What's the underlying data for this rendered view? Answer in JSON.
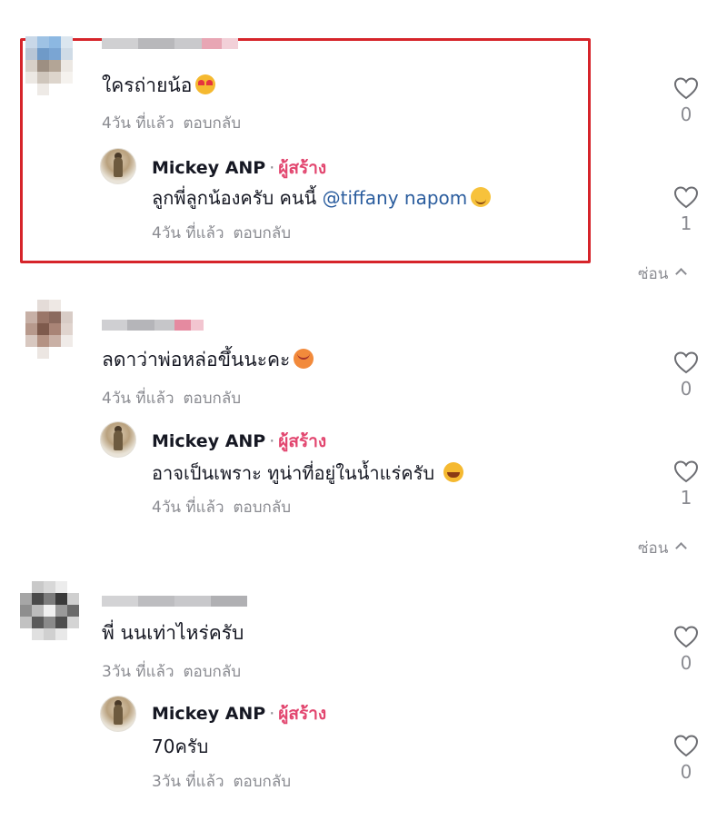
{
  "comments": [
    {
      "text": "ใครถ่ายน้อ",
      "emoji": "love-eyes-emoji",
      "time": "4วัน ที่แล้ว",
      "reply_label": "ตอบกลับ",
      "likes": "0",
      "reply": {
        "author": "Mickey ANP",
        "separator": "·",
        "badge": "ผู้สร้าง",
        "text_before": "ลูกพี่ลูกน้องครับ คนนี้ ",
        "mention": "@tiffany napom",
        "emoji": "smile-emoji",
        "time": "4วัน ที่แล้ว",
        "reply_label": "ตอบกลับ",
        "likes": "1"
      },
      "hide_label": "ซ่อน"
    },
    {
      "text": "ลดาว่าพ่อหล่อขึ้นนะคะ",
      "emoji": "blushing-hearts-emoji",
      "time": "4วัน ที่แล้ว",
      "reply_label": "ตอบกลับ",
      "likes": "0",
      "reply": {
        "author": "Mickey ANP",
        "separator": "·",
        "badge": "ผู้สร้าง",
        "text": "อาจเป็นเพราะ ทูน่าที่อยู่ในน้ำแร่ครับ ",
        "emoji": "grin-emoji",
        "time": "4วัน ที่แล้ว",
        "reply_label": "ตอบกลับ",
        "likes": "1"
      },
      "hide_label": "ซ่อน"
    },
    {
      "text": "พี่ นนเท่าไหร่ครับ",
      "time": "3วัน ที่แล้ว",
      "reply_label": "ตอบกลับ",
      "likes": "0",
      "reply": {
        "author": "Mickey ANP",
        "separator": "·",
        "badge": "ผู้สร้าง",
        "text": "70ครับ",
        "time": "3วัน ที่แล้ว",
        "reply_label": "ตอบกลับ",
        "likes": "0"
      }
    }
  ],
  "colors": {
    "text": "#161823",
    "muted": "#8a8b91",
    "creator_badge": "#e2466f",
    "mention": "#2b5d9e",
    "highlight_border": "#d6242a"
  },
  "icons": {
    "like": "heart-outline-icon",
    "collapse": "chevron-up-icon"
  }
}
